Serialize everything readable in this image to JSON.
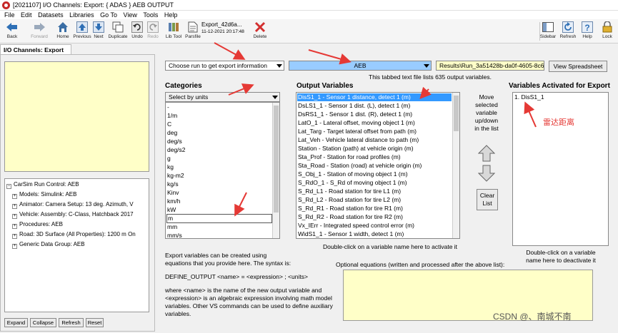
{
  "window": {
    "title": "[2021107] I/O Channels: Export: { ADAS } AEB OUTPUT"
  },
  "menu": [
    "File",
    "Edit",
    "Datasets",
    "Libraries",
    "Go To",
    "View",
    "Tools",
    "Help"
  ],
  "toolbar": {
    "back": "Back",
    "forward": "Forward",
    "home": "Home",
    "previous": "Previous",
    "next": "Next",
    "duplicate": "Duplicate",
    "undo": "Undo",
    "redo": "Redo",
    "libtool": "Lib Tool",
    "parsfile": "Parsfile",
    "delete": "Delete",
    "sidebar": "Sidebar",
    "refresh": "Refresh",
    "help": "Help",
    "lock": "Lock",
    "parsfile_name": "Export_42d6a...",
    "parsfile_date": "11-12-2021 20:17:48"
  },
  "left_panel": {
    "tab": "I/O Channels: Export",
    "tree": [
      "CarSim Run Control: AEB",
      "Models: Simulink: AEB",
      "Animator: Camera Setup: 13 deg. Azimuth, V",
      "Vehicle: Assembly: C-Class, Hatchback 2017",
      "Procedures: AEB",
      "Road: 3D Surface (All Properties): 1200 m On",
      "Generic Data Group: AEB"
    ],
    "buttons": {
      "expand": "Expand",
      "collapse": "Collapse",
      "refresh": "Refresh",
      "reset": "Reset"
    }
  },
  "main": {
    "run_dropdown": "Choose run to get export information",
    "run_value": "AEB",
    "results_path": "Results\\Run_3a51428b-da0f-4605-8c6",
    "view_spreadsheet": "View Spreadsheet",
    "file_info": "This tabbed text file lists 635 output variables.",
    "categories": {
      "header": "Categories",
      "dropdown": "Select by units",
      "items": [
        "-",
        "1/m",
        "C",
        "deg",
        "deg/s",
        "deg/s2",
        "g",
        "kg",
        "kg-m2",
        "kg/s",
        "Kinv",
        "km/h",
        "kW",
        "m",
        "mm",
        "mm/s"
      ],
      "selected": "m"
    },
    "output_variables": {
      "header": "Output Variables",
      "items": [
        "DisS1_1 - Sensor 1 distance, detect 1 (m)",
        "DsLS1_1 - Sensor 1 dist. (L), detect 1 (m)",
        "DsRS1_1 - Sensor 1 dist. (R), detect 1 (m)",
        "LatO_1 - Lateral offset, moving object 1 (m)",
        "Lat_Targ - Target lateral offset from path (m)",
        "Lat_Veh - Vehicle lateral distance to path (m)",
        "Station - Station (path) at vehicle origin (m)",
        "Sta_Prof - Station for road profiles (m)",
        "Sta_Road - Station (road) at vehicle origin (m)",
        "S_Obj_1 - Station of moving object 1 (m)",
        "S_RdO_1 - S_Rd of moving object 1 (m)",
        "S_Rd_L1 - Road station for tire L1 (m)",
        "S_Rd_L2 - Road station for tire L2 (m)",
        "S_Rd_R1 - Road station for tire R1 (m)",
        "S_Rd_R2 - Road station for tire R2 (m)",
        "Vx_IErr - Integrated speed control error (m)",
        "WidS1_1 - Sensor 1 width, detect 1 (m)"
      ],
      "hint": "Double-click on a variable name here to activate it"
    },
    "move_hint": [
      "Move",
      "selected",
      "variable",
      "up/down",
      "in the list"
    ],
    "clear_list": [
      "Clear",
      "List"
    ],
    "activated": {
      "header": "Variables Activated for Export",
      "items": [
        "1. DisS1_1"
      ],
      "annotation": "雷达距离",
      "hint": [
        "Double-click on a variable",
        "name here to deactivate it"
      ]
    },
    "help_text": [
      "Export variables can be created using",
      "equations that you provide here. The syntax is:",
      "",
      "DEFINE_OUTPUT <name> = <expression> ; <units>",
      "",
      "where <name> is the name of the new output variable and",
      "<expression> is an algebraic expression involving math model",
      "variables. Other VS commands can be used to define auxiliary",
      "variables."
    ],
    "optional_eq_label": "Optional equations (written and processed after the above list):",
    "watermark": "CSDN @、南城不南"
  },
  "colors": {
    "selection": "#3399ff",
    "yellow_box": "#ffffc8",
    "annotation_red": "#e53935",
    "run_field": "#99ccff"
  }
}
